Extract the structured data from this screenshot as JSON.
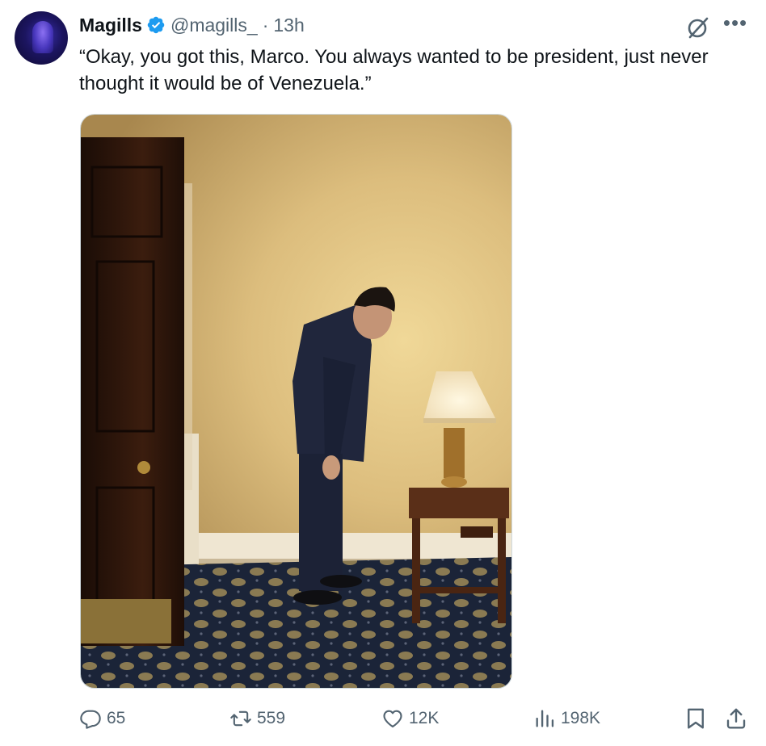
{
  "tweet": {
    "author_name": "Magills",
    "handle": "@magills_",
    "separator": "·",
    "time": "13h",
    "text": "“Okay, you got this, Marco. You always wanted to be president, just never thought it would be of Venezuela.”",
    "verified_color": "#1d9bf0"
  },
  "header_icons": [
    "grok-icon",
    "more-options-icon"
  ],
  "media": {
    "description_icon": "photo"
  },
  "actions": {
    "replies": "65",
    "reposts": "559",
    "likes": "12K",
    "views": "198K",
    "icons": [
      "reply-icon",
      "repost-icon",
      "like-icon",
      "views-icon",
      "bookmark-icon",
      "share-icon"
    ]
  },
  "colors": {
    "text": "#0f1419",
    "secondary": "#536471",
    "wall": "#d9b878",
    "carpet": "#1b2438"
  }
}
